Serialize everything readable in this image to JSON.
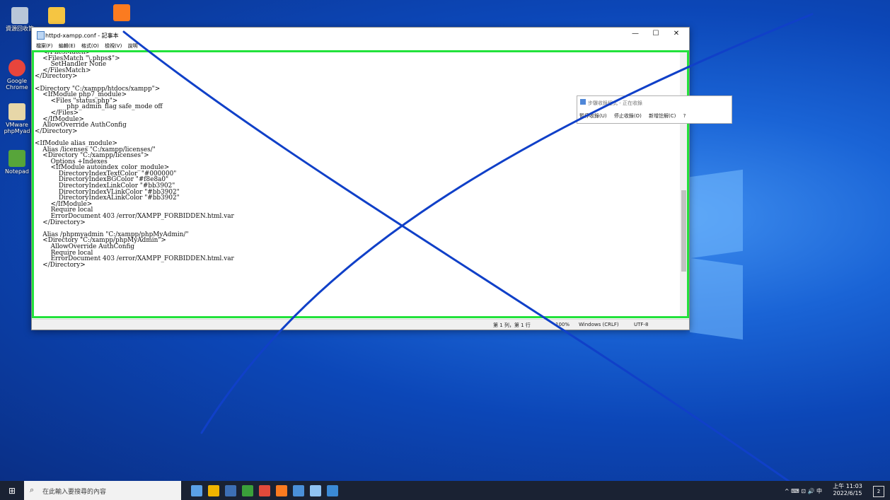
{
  "desktop": {
    "icons": [
      {
        "label": "資源回收筒",
        "color": "#b8c6d8"
      },
      {
        "label": "",
        "color": "#f5c542"
      },
      {
        "label": "",
        "color": "#fb7b20"
      },
      {
        "label": "Google Chrome",
        "color": "#e8453c"
      },
      {
        "label": "VMware phpMyad",
        "color": "#e7d7a8"
      },
      {
        "label": "Notepad",
        "color": "#57a53a"
      }
    ]
  },
  "notepad": {
    "title": "httpd-xampp.conf - 記事本",
    "controls": {
      "minimize": "—",
      "maximize": "☐",
      "close": "✕"
    },
    "menu": [
      "檔案(F)",
      "編輯(E)",
      "格式(O)",
      "檢視(V)",
      "說明"
    ],
    "lines": [
      "    </FilesMatch>",
      "    <FilesMatch \"\\.phps$\">",
      "        SetHandler None",
      "    </FilesMatch>",
      "</Directory>",
      "",
      "<Directory \"C:/xampp/htdocs/xampp\">",
      "    <IfModule php7_module>",
      "        <Files \"status.php\">",
      "                php_admin_flag safe_mode off",
      "        </Files>",
      "    </IfModule>",
      "    AllowOverride AuthConfig",
      "</Directory>",
      "",
      "<IfModule alias_module>",
      "    Alias /licenses \"C:/xampp/licenses/\"",
      "    <Directory \"C:/xampp/licenses\">",
      "        Options +Indexes",
      "        <IfModule autoindex_color_module>",
      "            DirectoryIndexTextColor  \"#000000\"",
      "            DirectoryIndexBGColor \"#f8e8a0\"",
      "            DirectoryIndexLinkColor \"#bb3902\"",
      "            DirectoryIndexVLinkColor \"#bb3902\"",
      "            DirectoryIndexALinkColor \"#bb3902\"",
      "        </IfModule>",
      "        Require local",
      "        ErrorDocument 403 /error/XAMPP_FORBIDDEN.html.var",
      "    </Directory>",
      "",
      "    Alias /phpmyadmin \"C:/xampp/phpMyAdmin/\"",
      "    <Directory \"C:/xampp/phpMyAdmin\">",
      "        AllowOverride AuthConfig",
      "        Require local",
      "        ErrorDocument 403 /error/XAMPP_FORBIDDEN.html.var",
      "    </Directory>"
    ],
    "status": {
      "position": "第 1 列，第 1 行",
      "zoom": "100%",
      "eol": "Windows (CRLF)",
      "encoding": "UTF-8"
    }
  },
  "steps_recorder": {
    "title": "步驟收錄程式 - 正在收錄",
    "pause": "暫停收錄(U)",
    "stop": "停止收錄(O)",
    "comment": "新增註解(C)",
    "help": "?"
  },
  "taskbar": {
    "search_placeholder": "在此輸入要搜尋的內容",
    "apps": [
      "#5aa0e6",
      "#f0b400",
      "#3d6fb5",
      "#3aa03a",
      "#e24a3b",
      "#fb7b20",
      "#4a90d9",
      "#8fc3f3",
      "#3a8ad6"
    ],
    "tray": "^ ⌨ ⊡ 🔊 中",
    "time": "上午 11:03",
    "date": "2022/6/15",
    "notifications": "2"
  },
  "annotation": {
    "colors": {
      "highlight": "#22e23c",
      "line": "#1040c8"
    }
  }
}
